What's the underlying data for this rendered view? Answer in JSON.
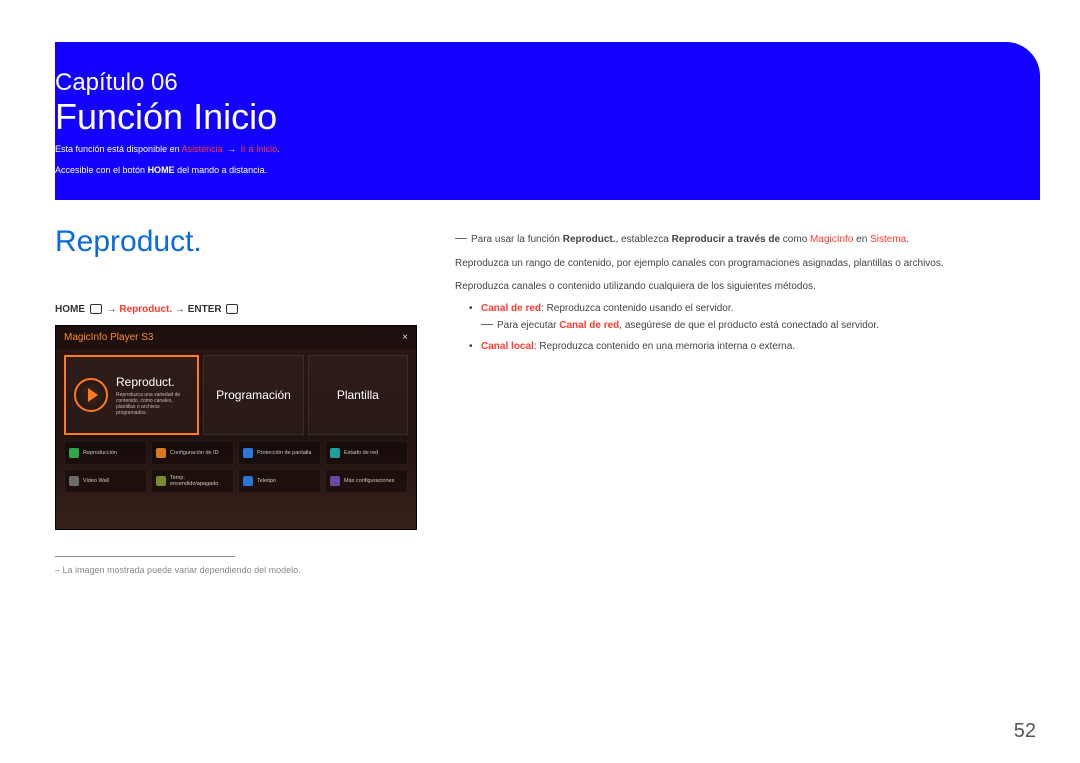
{
  "banner": {
    "chapter": "Capítulo 06",
    "title": "Función Inicio",
    "note1_pre": "Esta función está disponible en ",
    "note1_hl1": "Asistencia",
    "note1_arrow": " → ",
    "note1_hl2": "Ir a Inicio",
    "note1_post": ".",
    "note2_pre": "Accesible con el botón ",
    "note2_bold": "HOME",
    "note2_post": " del mando a distancia."
  },
  "left": {
    "sectionTitle": "Reproduct.",
    "nav": {
      "home": "HOME",
      "arrow1": " → ",
      "mid": "Reproduct.",
      "arrow2": " →",
      "enter": "ENTER"
    },
    "mock": {
      "headerName": "MagicInfo Player S3",
      "tiles": [
        {
          "label": "Reproduct.",
          "desc": "Reproduzca una variedad de contenido, como canales, plantillas o archivos programados.",
          "selected": true
        },
        {
          "label": "Programación"
        },
        {
          "label": "Plantilla"
        }
      ],
      "smallItems": [
        {
          "label": "Reproducción",
          "color": "green"
        },
        {
          "label": "Configuración de ID",
          "color": "orange"
        },
        {
          "label": "Protección de pantalla",
          "color": "blue"
        },
        {
          "label": "Estado de red",
          "color": "teal"
        },
        {
          "label": "Video Wall",
          "color": "gray"
        },
        {
          "label": "Temp. encendido/apagado",
          "color": "olive"
        },
        {
          "label": "Teletipo",
          "color": "blue"
        },
        {
          "label": "Más configuraciones",
          "color": "purple"
        }
      ]
    },
    "footnote": "La imagen mostrada puede variar dependiendo del modelo."
  },
  "right": {
    "line1_pre": "Para usar la función ",
    "line1_b1": "Reproduct.",
    "line1_mid1": ", establezca ",
    "line1_b2": "Reproducir a través de",
    "line1_mid2": " como ",
    "line1_hl1": "MagicInfo",
    "line1_mid3": " en ",
    "line1_hl2": "Sistema",
    "line1_post": ".",
    "para1": "Reproduzca un rango de contenido, por ejemplo canales con programaciones asignadas, plantillas o archivos.",
    "para2": "Reproduzca canales o contenido utilizando cualquiera de los siguientes métodos.",
    "bullets": [
      {
        "hl": "Canal de red",
        "rest": ": Reproduzca contenido usando el servidor.",
        "subnote_pre": "Para ejecutar ",
        "subnote_hl": "Canal de red",
        "subnote_post": ", asegúrese de que el producto está conectado al servidor."
      },
      {
        "hl": "Canal local",
        "rest": ": Reproduzca contenido en una memoria interna o externa."
      }
    ]
  },
  "pageNumber": "52"
}
